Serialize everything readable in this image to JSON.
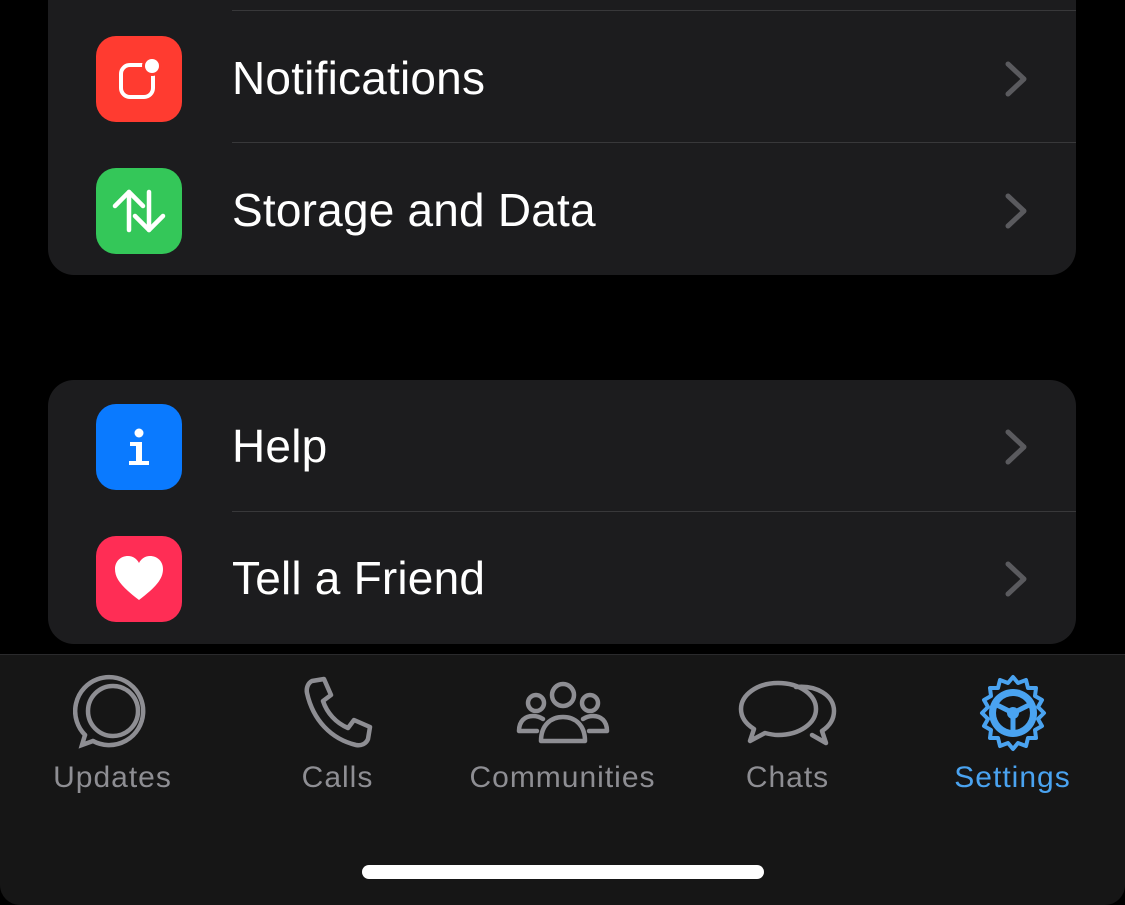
{
  "groups": [
    {
      "items": [
        {
          "label": "Notifications",
          "icon": "notification-badge-icon",
          "color": "#ff3b30"
        },
        {
          "label": "Storage and Data",
          "icon": "up-down-arrows-icon",
          "color": "#34c759"
        }
      ]
    },
    {
      "items": [
        {
          "label": "Help",
          "icon": "info-icon",
          "color": "#0a7aff"
        },
        {
          "label": "Tell a Friend",
          "icon": "heart-icon",
          "color": "#ff2d55"
        }
      ]
    }
  ],
  "tabbar": {
    "tabs": [
      {
        "label": "Updates",
        "icon": "updates-icon",
        "active": false
      },
      {
        "label": "Calls",
        "icon": "phone-icon",
        "active": false
      },
      {
        "label": "Communities",
        "icon": "communities-icon",
        "active": false
      },
      {
        "label": "Chats",
        "icon": "chats-icon",
        "active": false
      },
      {
        "label": "Settings",
        "icon": "settings-gear-icon",
        "active": true
      }
    ],
    "active_color": "#4aa3f0",
    "inactive_color": "#8e8e93"
  }
}
